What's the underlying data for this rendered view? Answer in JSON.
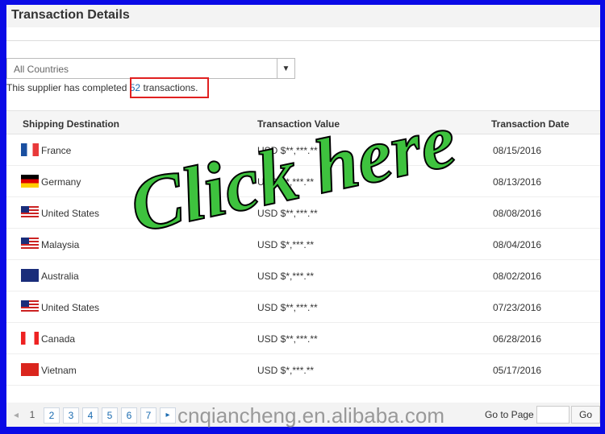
{
  "title": "Transaction Details",
  "filter": {
    "value": "All Countries"
  },
  "info": {
    "prefix": "This supplier has completed ",
    "count": "52",
    "suffix": " transactions."
  },
  "table": {
    "headers": [
      "Shipping Destination",
      "Transaction Value",
      "Transaction Date"
    ],
    "rows": [
      {
        "country": "France",
        "flag": "fr",
        "value": "USD $**,***.**",
        "date": "08/15/2016"
      },
      {
        "country": "Germany",
        "flag": "de",
        "value": "USD $*,***.**",
        "date": "08/13/2016"
      },
      {
        "country": "United States",
        "flag": "us",
        "value": "USD $**,***.**",
        "date": "08/08/2016"
      },
      {
        "country": "Malaysia",
        "flag": "my",
        "value": "USD $*,***.**",
        "date": "08/04/2016"
      },
      {
        "country": "Australia",
        "flag": "au",
        "value": "USD $*,***.**",
        "date": "08/02/2016"
      },
      {
        "country": "United States",
        "flag": "us",
        "value": "USD $**,***.**",
        "date": "07/23/2016"
      },
      {
        "country": "Canada",
        "flag": "ca",
        "value": "USD $**,***.**",
        "date": "06/28/2016"
      },
      {
        "country": "Vietnam",
        "flag": "vn",
        "value": "USD $*,***.**",
        "date": "05/17/2016"
      }
    ]
  },
  "pagination": {
    "prev": "◂",
    "next": "▸",
    "current": "1",
    "pages": [
      "2",
      "3",
      "4",
      "5",
      "6",
      "7"
    ],
    "goto_label": "Go to Page",
    "go_label": "Go"
  },
  "watermark": "cnqiancheng.en.alibaba.com",
  "overlay": "Click here",
  "colors": {
    "frame": "#0a0ae6",
    "overlay": "#3ec23e",
    "highlight": "#e02020",
    "link": "#1a6bb0"
  }
}
